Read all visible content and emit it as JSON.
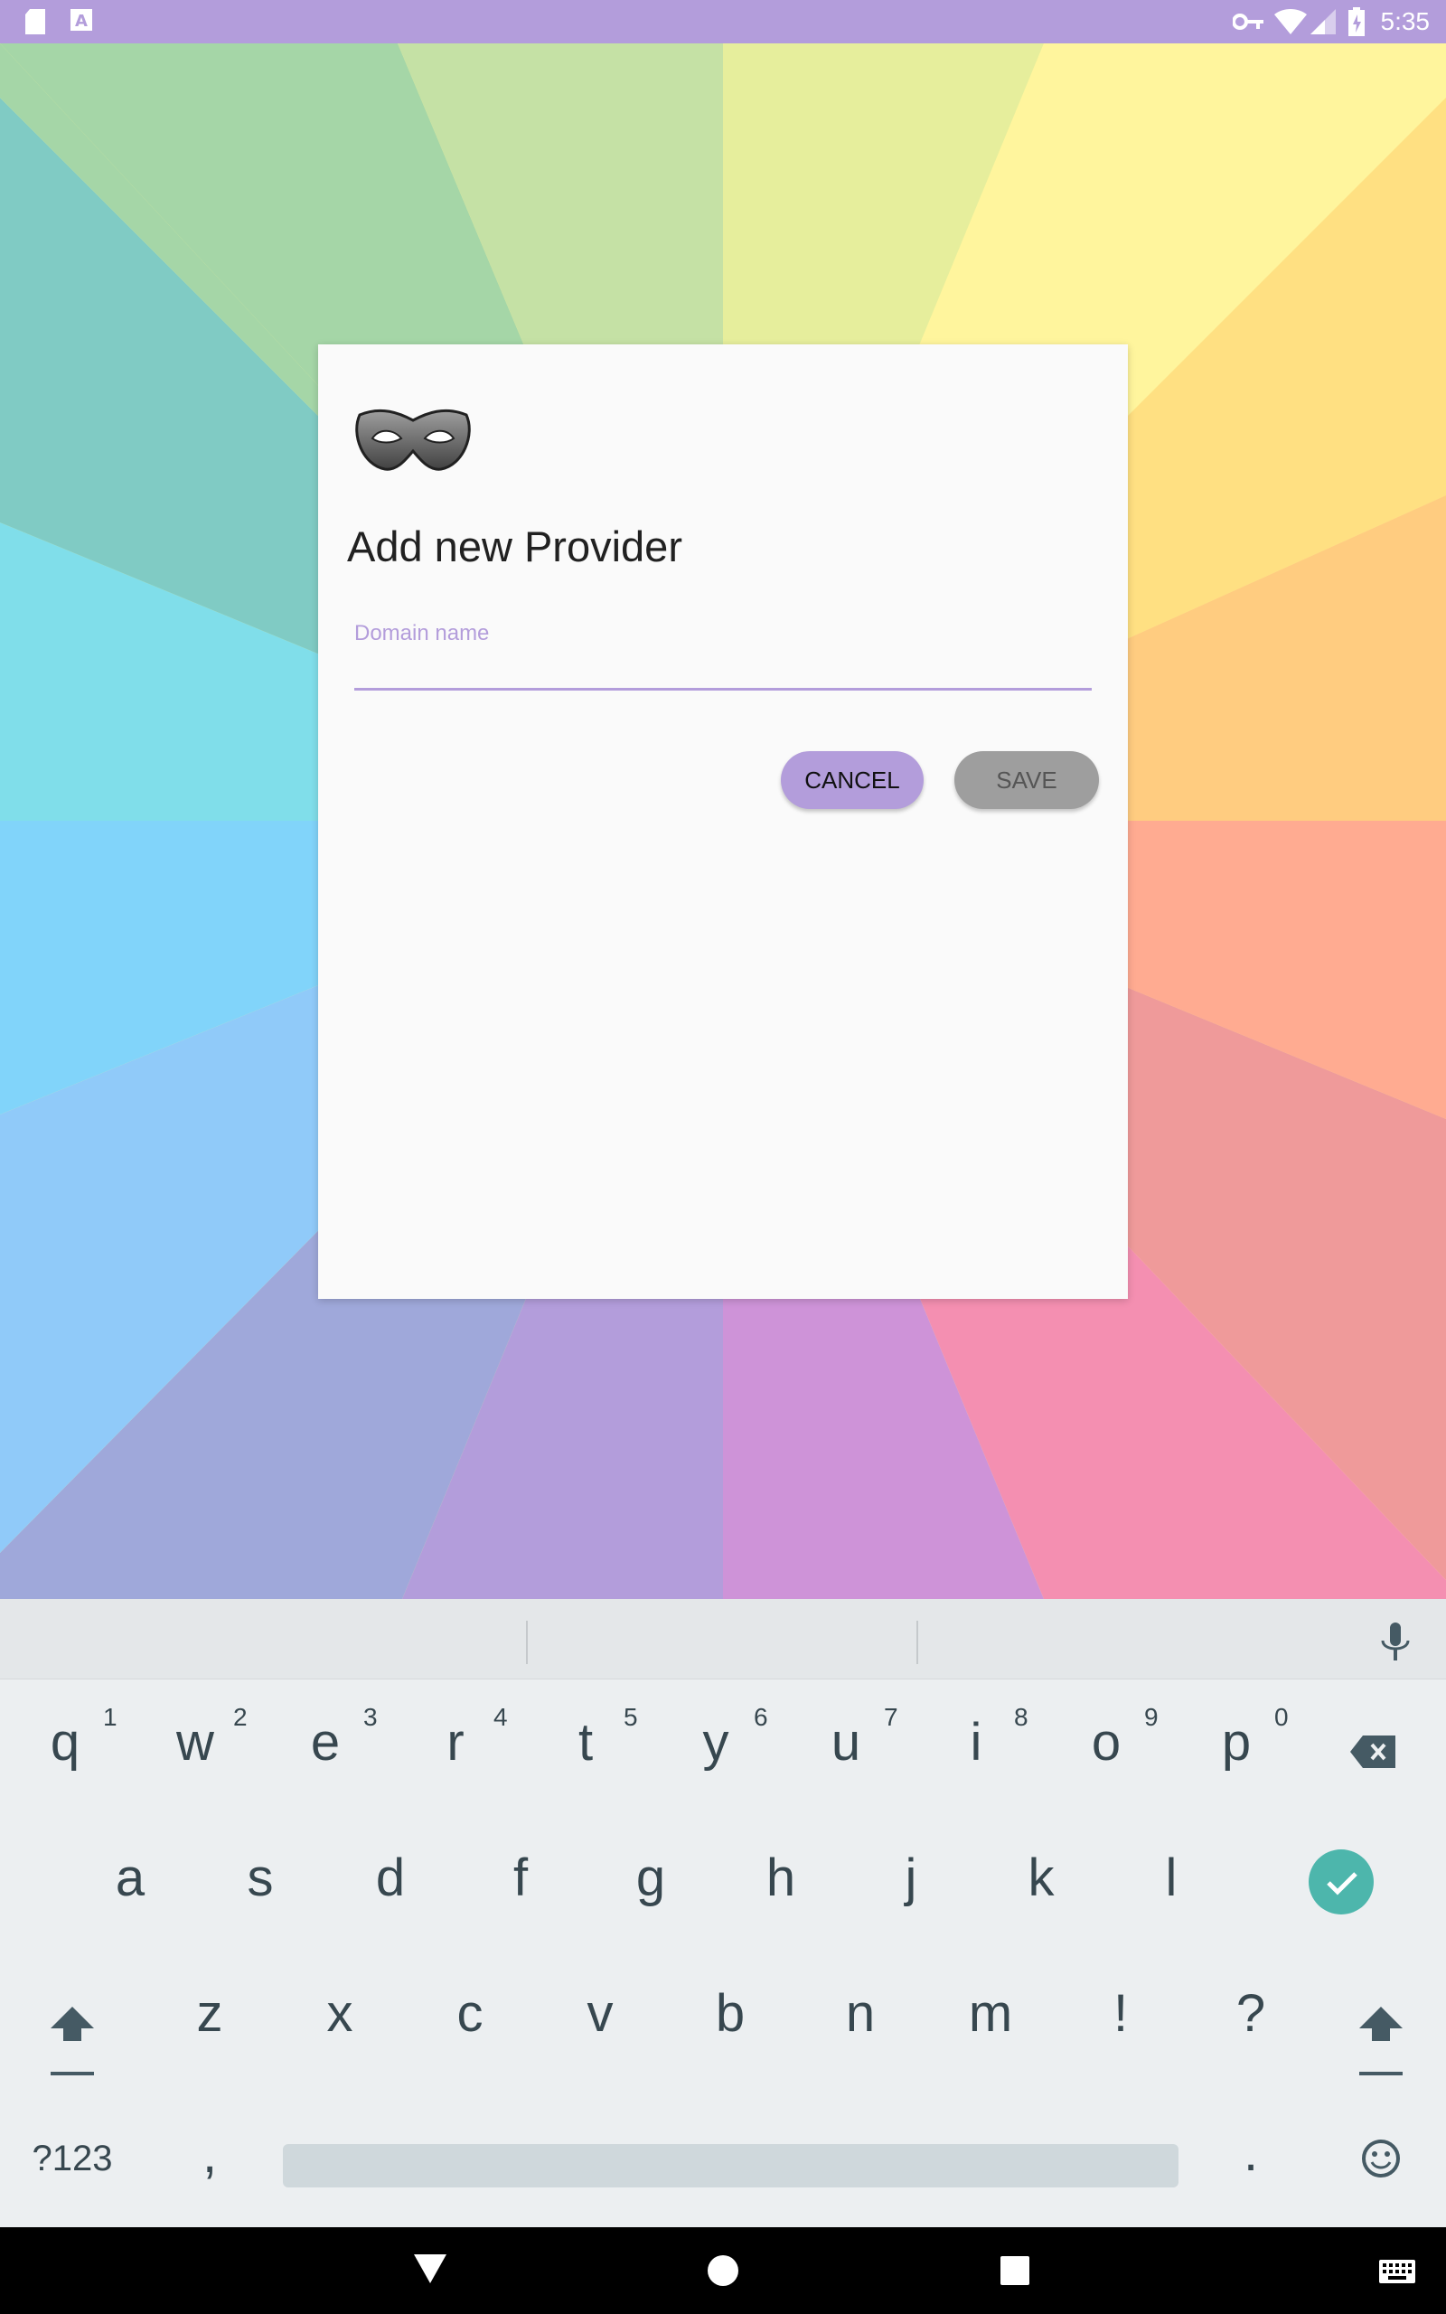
{
  "status_bar": {
    "time": "5:35"
  },
  "dialog": {
    "title": "Add new Provider",
    "domain_label": "Domain name",
    "domain_value": "",
    "cancel_label": "CANCEL",
    "save_label": "SAVE"
  },
  "keyboard": {
    "row1": [
      {
        "ch": "q",
        "hint": "1"
      },
      {
        "ch": "w",
        "hint": "2"
      },
      {
        "ch": "e",
        "hint": "3"
      },
      {
        "ch": "r",
        "hint": "4"
      },
      {
        "ch": "t",
        "hint": "5"
      },
      {
        "ch": "y",
        "hint": "6"
      },
      {
        "ch": "u",
        "hint": "7"
      },
      {
        "ch": "i",
        "hint": "8"
      },
      {
        "ch": "o",
        "hint": "9"
      },
      {
        "ch": "p",
        "hint": "0"
      }
    ],
    "row2": [
      "a",
      "s",
      "d",
      "f",
      "g",
      "h",
      "j",
      "k",
      "l"
    ],
    "row3": [
      "z",
      "x",
      "c",
      "v",
      "b",
      "n",
      "m",
      "!",
      "?"
    ],
    "symbols_label": "?123",
    "comma": ",",
    "period": "."
  },
  "colors": {
    "accent": "#b39ddb",
    "save_disabled": "#9e9e9e",
    "done_key": "#4db6ac"
  }
}
